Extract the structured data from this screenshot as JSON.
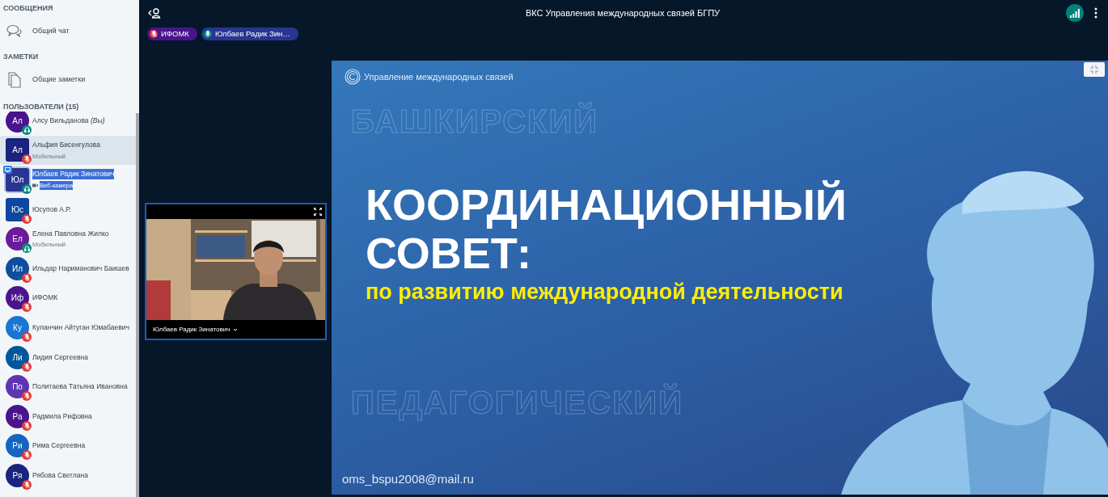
{
  "sidebar": {
    "sections": [
      {
        "title": "СООБЩЕНИЯ",
        "items": [
          {
            "kind": "chat",
            "label": "Общий чат"
          }
        ]
      },
      {
        "title": "ЗАМЕТКИ",
        "items": [
          {
            "kind": "notes",
            "label": "Общие заметки"
          }
        ]
      }
    ],
    "users_title": "ПОЛЬЗОВАТЕЛИ (15)",
    "users": [
      {
        "initials": "Ал",
        "name": "Алсу Вильданова *(Вы)*",
        "color": "#4a148c",
        "moderator": false,
        "listen_only": true,
        "selected": false
      },
      {
        "initials": "Ал",
        "name": "Альфия Бисенгулова",
        "status": {
          "kind": "mobile",
          "label": "Мобильный"
        },
        "color": "#1a237e",
        "moderator": true,
        "listen_only": false,
        "selected": true
      },
      {
        "initials": "Юл",
        "name": "Юлбаев Радик Зинатович",
        "status": {
          "kind": "webcam",
          "label": "Веб-камера"
        },
        "color": "#283593",
        "moderator": true,
        "presenter": true,
        "text_selected": true,
        "listen_only": true,
        "selected": false
      },
      {
        "initials": "Юс",
        "name": "Юсупов А.Р.",
        "color": "#0d47a1",
        "moderator": true,
        "listen_only": false,
        "selected": false
      },
      {
        "initials": "Ел",
        "name": "Елена Павловна Жилко",
        "status": {
          "kind": "mobile",
          "label": "Мобильный"
        },
        "color": "#6a1b9a",
        "moderator": false,
        "listen_only": true,
        "selected": false
      },
      {
        "initials": "Ил",
        "name": "Ильдар Нариманович Баишев",
        "color": "#0d4f9e",
        "moderator": false,
        "listen_only": false,
        "selected": false
      },
      {
        "initials": "Иф",
        "name": "ИФОМК",
        "color": "#4a148c",
        "moderator": false,
        "listen_only": false,
        "selected": false
      },
      {
        "initials": "Ку",
        "name": "Куланчин Айтуган Юмабаевич",
        "color": "#1976d2",
        "moderator": false,
        "listen_only": false,
        "selected": false
      },
      {
        "initials": "Ли",
        "name": "Лидия Сергеевна",
        "color": "#01579b",
        "moderator": false,
        "listen_only": false,
        "selected": false
      },
      {
        "initials": "По",
        "name": "Политаева Татьяна Ивановна",
        "color": "#5e35b1",
        "moderator": false,
        "listen_only": false,
        "selected": false
      },
      {
        "initials": "Ра",
        "name": "Радмила Рифовна",
        "color": "#4a148c",
        "moderator": false,
        "listen_only": false,
        "selected": false
      },
      {
        "initials": "Ри",
        "name": "Рима Сергеевна",
        "color": "#1565c0",
        "moderator": false,
        "listen_only": false,
        "selected": false
      },
      {
        "initials": "Ря",
        "name": "Рябова Светлана",
        "color": "#1a237e",
        "moderator": false,
        "listen_only": false,
        "selected": false
      }
    ]
  },
  "header": {
    "title": "ВКС Управления международных связей БГПУ"
  },
  "talkers": [
    {
      "label": "ИФОМК",
      "muted": true,
      "color": "#4a148c"
    },
    {
      "label": "Юлбаев Радик Зин…",
      "muted": false,
      "color": "#283593"
    }
  ],
  "webcam": {
    "name": "Юлбаев Радик Зинатович"
  },
  "slide": {
    "org": "Управление международных связей",
    "word_top": "БАШКИРСКИЙ",
    "title_lines": [
      "КООРДИНАЦИОННЫЙ",
      "СОВЕТ:"
    ],
    "subtitle": "по развитию международной деятельности",
    "word_bottom": "ПЕДАГОГИЧЕСКИЙ",
    "email": "oms_bspu2008@mail.ru"
  }
}
